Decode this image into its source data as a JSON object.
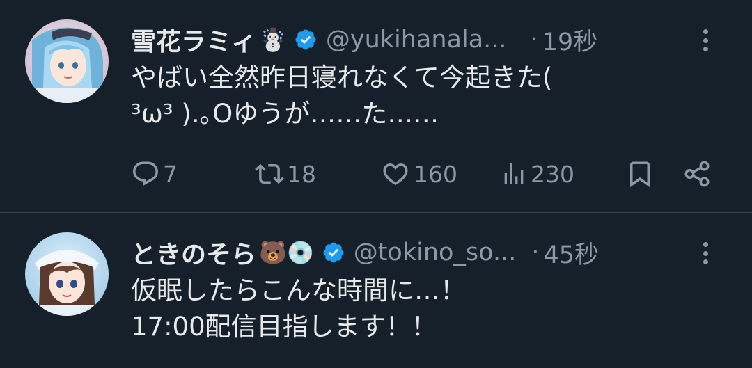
{
  "tweets": [
    {
      "display_name": "雪花ラミィ",
      "name_emoji": "☃️",
      "handle": "@yukihanala...",
      "separator": "·",
      "time": "19秒",
      "text": "やばい全然昨日寝れなくて今起きた(\n³ω³ ).｡Oゆうが……た……",
      "actions": {
        "replies": "7",
        "retweets": "18",
        "likes": "160",
        "views": "230"
      }
    },
    {
      "display_name": "ときのそら",
      "name_emoji": "🐻💿",
      "handle": "@tokino_so...",
      "separator": "·",
      "time": "45秒",
      "text": "仮眠したらこんな時間に…！\n17:00配信目指します！！"
    }
  ],
  "colors": {
    "background": "#15202b",
    "text": "#e7e9ea",
    "secondary": "#8b98a5",
    "verified": "#1d9bf0",
    "divider": "#38444d"
  },
  "icons": [
    "verified-badge-icon",
    "more-icon",
    "reply-icon",
    "retweet-icon",
    "like-icon",
    "views-icon",
    "bookmark-icon",
    "share-icon"
  ]
}
